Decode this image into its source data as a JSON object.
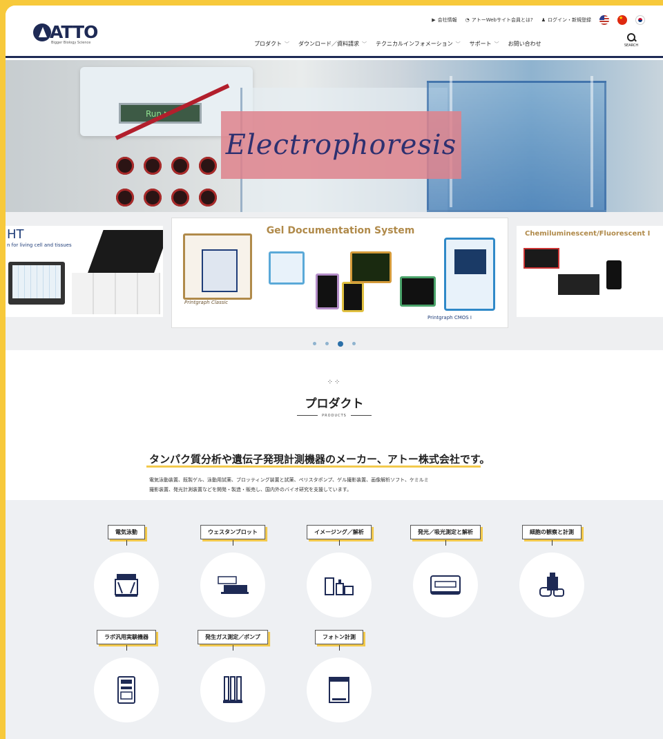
{
  "brand": {
    "name": "ATTO",
    "tagline": "Bigger Biology Science"
  },
  "topbar": {
    "company": "会社情報",
    "about_web": "アトーWebサイト会員とは?",
    "login": "ログイン・新規登録"
  },
  "nav": [
    {
      "label": "プロダクト",
      "has_menu": true
    },
    {
      "label": "ダウンロード／資料請求",
      "has_menu": true
    },
    {
      "label": "テクニカルインフォメーション",
      "has_menu": true
    },
    {
      "label": "サポート",
      "has_menu": true
    },
    {
      "label": "お問い合わせ",
      "has_menu": false
    }
  ],
  "search_label": "SEARCH",
  "hero": {
    "title": "Electrophoresis",
    "screen_text": "Run"
  },
  "carousel": {
    "left": {
      "title": "HT",
      "subtitle": "n for living cell and tissues"
    },
    "center": {
      "title": "Gel Documentation System",
      "caption_left": "Printgraph Classic",
      "caption_right": "Printgraph CMOS I"
    },
    "right": {
      "title": "Chemiluminescent/Fluorescent I"
    },
    "dots": 4,
    "active_dot": 2
  },
  "products": {
    "title": "プロダクト",
    "subtitle": "PRODUCTS",
    "headline": "タンパク質分析や遺伝子発現計測機器のメーカー、アトー株式会社です。",
    "description_line1": "電気泳動装置、既製ゲル、泳動用試薬、ブロッティング装置と試薬、ペリスタポンプ、ゲル撮影装置、画像解析ソフト、ケミルミ",
    "description_line2": "撮影装置、発光計測装置などを開発・製造・販売し、国内外のバイオ研究を支援しています。"
  },
  "categories": [
    {
      "label": "電気泳動",
      "icon": "electrophoresis-icon"
    },
    {
      "label": "ウェスタンブロット",
      "icon": "western-blot-icon"
    },
    {
      "label": "イメージング／解析",
      "icon": "imaging-icon"
    },
    {
      "label": "発光／吸光測定と解析",
      "icon": "luminometer-icon"
    },
    {
      "label": "細胞の観察と計測",
      "icon": "cell-culture-icon"
    },
    {
      "label": "ラボ汎用実験機器",
      "icon": "lab-equipment-icon"
    },
    {
      "label": "発生ガス測定／ポンプ",
      "icon": "gas-pump-icon"
    },
    {
      "label": "フォトン計測",
      "icon": "photon-counter-icon"
    }
  ],
  "colors": {
    "navy": "#1e2a55",
    "accent_yellow": "#f2c94c",
    "frame_yellow": "#f7c93b"
  }
}
